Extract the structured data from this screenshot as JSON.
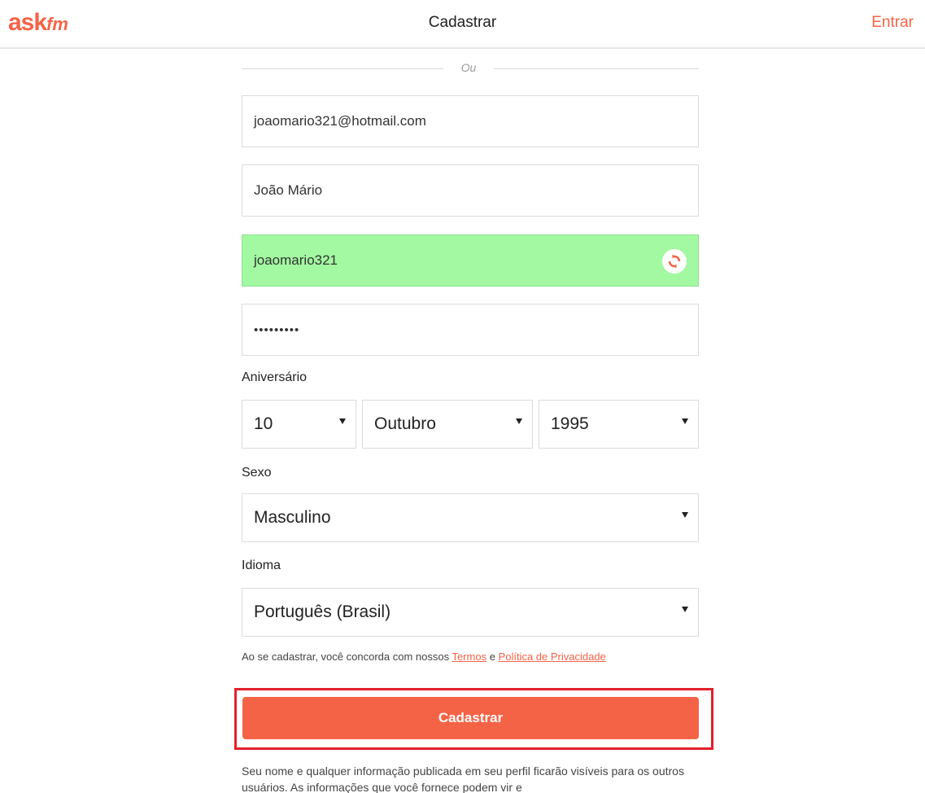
{
  "header": {
    "logo_main": "ask",
    "logo_suffix": "fm",
    "title": "Cadastrar",
    "login_label": "Entrar"
  },
  "divider": {
    "or_label": "Ou"
  },
  "form": {
    "email_value": "joaomario321@hotmail.com",
    "name_value": "João Mário",
    "username_value": "joaomario321",
    "password_value": "•••••••••",
    "birthday_label": "Aniversário",
    "birthday_day": "10",
    "birthday_month": "Outubro",
    "birthday_year": "1995",
    "gender_label": "Sexo",
    "gender_value": "Masculino",
    "language_label": "Idioma",
    "language_value": "Português (Brasil)"
  },
  "terms": {
    "prefix": "Ao se cadastrar, você concorda com nossos ",
    "terms_link": "Termos",
    "connector": " e ",
    "privacy_link": "Política de Privacidade"
  },
  "submit_label": "Cadastrar",
  "footer_text": "Seu nome e qualquer informação publicada em seu perfil ficarão visíveis para os outros usuários. As informações que você fornece podem vir e",
  "colors": {
    "brand": "#f56346",
    "valid_field": "#a2f9a1",
    "highlight": "#e3202c"
  }
}
